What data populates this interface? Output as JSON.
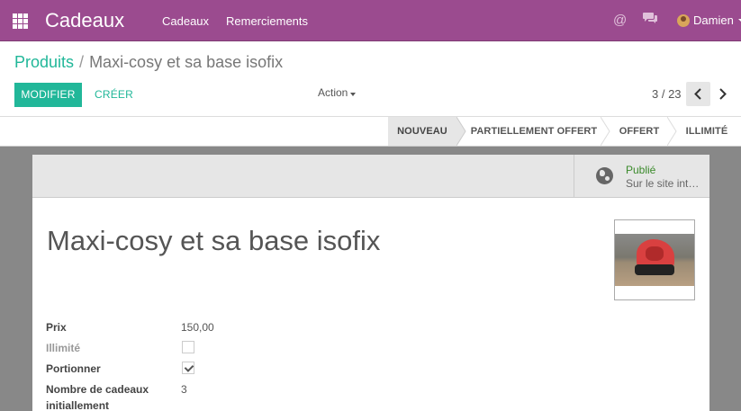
{
  "navbar": {
    "app_title": "Cadeaux",
    "menu": [
      "Cadeaux",
      "Remerciements"
    ],
    "user_name": "Damien",
    "icons": [
      "apps-grid-icon",
      "at-mention-icon",
      "chat-icon",
      "avatar"
    ],
    "color": "#9b4b8f"
  },
  "breadcrumb": {
    "parent": "Produits",
    "separator": "/",
    "current": "Maxi-cosy et sa base isofix"
  },
  "toolbar": {
    "edit_label": "MODIFIER",
    "create_label": "CRÉER",
    "action_label": "Action"
  },
  "pager": {
    "value": "3 / 23"
  },
  "statusbar": {
    "stages": [
      "NOUVEAU",
      "PARTIELLEMENT OFFERT",
      "OFFERT",
      "ILLIMITÉ"
    ],
    "active": "NOUVEAU"
  },
  "publish": {
    "state": "Publié",
    "subtitle": "Sur le site int…"
  },
  "record": {
    "title": "Maxi-cosy et sa base isofix"
  },
  "fields": {
    "price_label": "Prix",
    "price_value": "150,00",
    "unlimited_label": "Illimité",
    "unlimited_checked": false,
    "share_label": "Portionner",
    "share_checked": true,
    "initial_count_label_line1": "Nombre de cadeaux",
    "initial_count_label_line2": "initiallement",
    "initial_count_value": "3"
  },
  "colors": {
    "accent": "#21b799",
    "navbar": "#9b4b8f"
  }
}
